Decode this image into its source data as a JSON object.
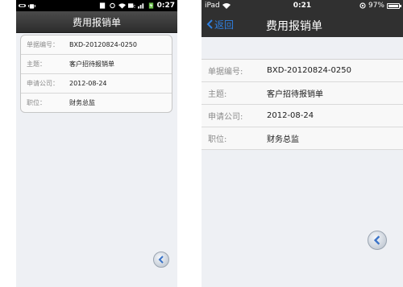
{
  "android": {
    "status_time": "0:27",
    "title": "费用报销单",
    "rows": [
      {
        "label": "单据编号：",
        "value": "BXD-20120824-0250"
      },
      {
        "label": "主题：",
        "value": "客户招待报销单"
      },
      {
        "label": "申请公司：",
        "value": "2012-08-24"
      },
      {
        "label": "职位：",
        "value": "财务总监"
      }
    ]
  },
  "ios": {
    "carrier": "iPad",
    "status_time": "0:21",
    "battery": "97%",
    "battery_level": 0.97,
    "back_label": "返回",
    "title": "费用报销单",
    "rows": [
      {
        "label": "单据编号:",
        "value": "BXD-20120824-0250"
      },
      {
        "label": "主题:",
        "value": "客户招待报销单"
      },
      {
        "label": "申请公司:",
        "value": "2012-08-24"
      },
      {
        "label": "职位:",
        "value": "财务总监"
      }
    ]
  },
  "colors": {
    "ios_accent": "#2f7fe0",
    "bar_dark": "#303030",
    "screen_bg": "#eef0f4"
  }
}
